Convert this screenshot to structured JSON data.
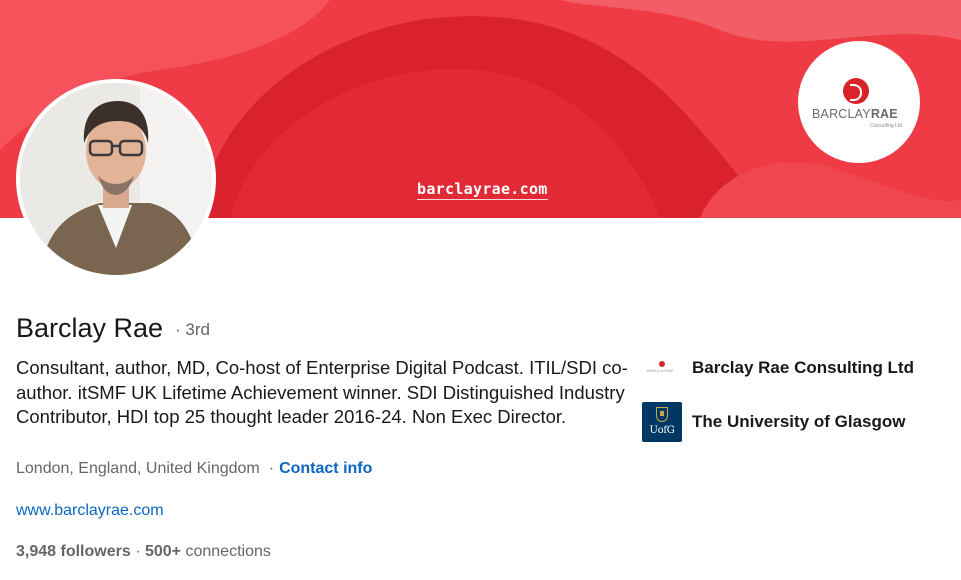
{
  "banner": {
    "url_text": "barclayrae.com",
    "brand_name_light": "BARCLAY",
    "brand_name_bold": "RAE",
    "brand_subtitle": "Consulting Ltd",
    "background_color": "#ee3b45"
  },
  "profile": {
    "name": "Barclay Rae",
    "degree": "· 3rd",
    "headline": "Consultant, author, MD, Co-host of Enterprise Digital Podcast. ITIL/SDI co-author. itSMF UK Lifetime Achievement winner. SDI Distinguished Industry Contributor, HDI top 25 thought leader 2016-24. Non Exec Director.",
    "location": "London, England, United Kingdom",
    "separator": "·",
    "contact_info": "Contact info",
    "website": "www.barclayrae.com",
    "followers_count": "3,948",
    "followers_label": "followers",
    "dot": "·",
    "connections_count": "500+",
    "connections_label": "connections"
  },
  "organizations": [
    {
      "name": "Barclay Rae Consulting Ltd",
      "logo": "barclay-rae-logo",
      "logo_text": "BARCLAYRAE"
    },
    {
      "name": "The University of Glasgow",
      "logo": "university-of-glasgow-logo",
      "logo_text": "UofG"
    }
  ],
  "colors": {
    "link": "#0a66c2",
    "text_primary": "#191919",
    "text_secondary": "#666666",
    "brand_red": "#d8232a",
    "uog_navy": "#003865"
  }
}
